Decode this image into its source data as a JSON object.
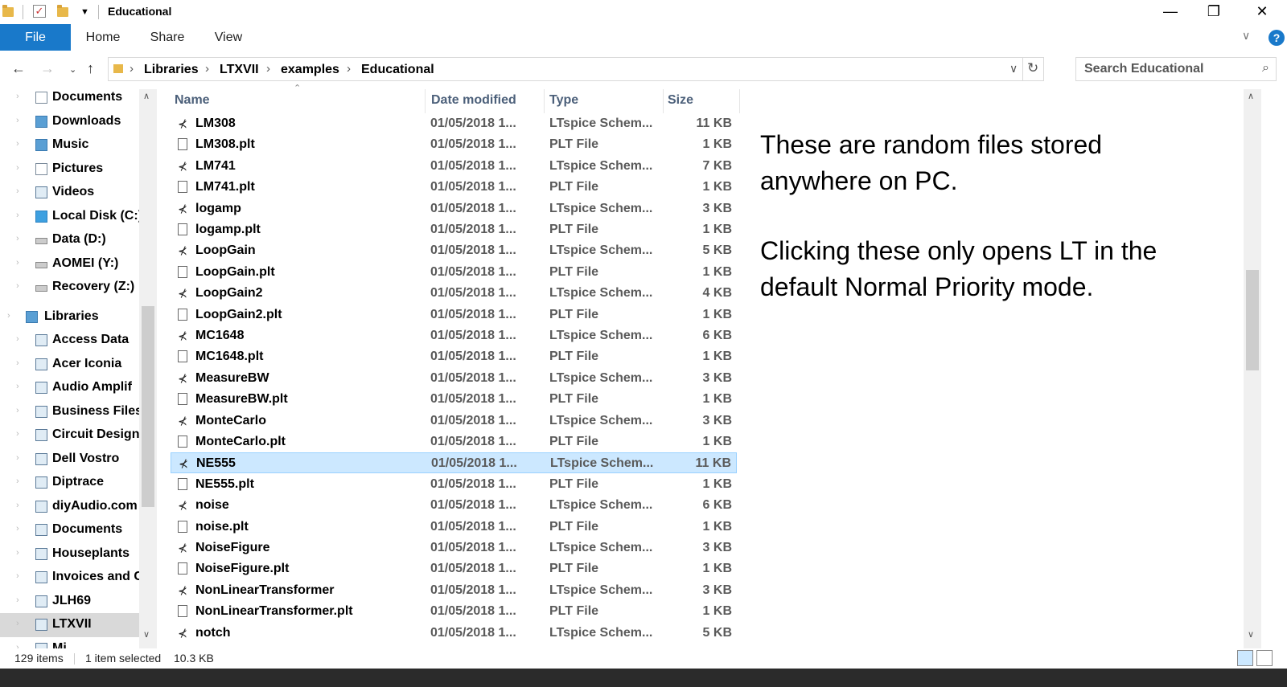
{
  "window": {
    "title": "Educational",
    "minimize": "—",
    "maximize": "❐",
    "close": "✕"
  },
  "ribbon": {
    "tabs": [
      "File",
      "Home",
      "Share",
      "View"
    ],
    "help": "?",
    "expand": "∨"
  },
  "address": {
    "crumbs": [
      "Libraries",
      "LTXVII",
      "examples",
      "Educational"
    ],
    "separator": "›",
    "search_placeholder": "Search Educational"
  },
  "nav": {
    "items": [
      {
        "label": "Documents",
        "icon": "documents-icon",
        "level": "child"
      },
      {
        "label": "Downloads",
        "icon": "downloads-icon",
        "level": "child"
      },
      {
        "label": "Music",
        "icon": "music-icon",
        "level": "child"
      },
      {
        "label": "Pictures",
        "icon": "pictures-icon",
        "level": "child"
      },
      {
        "label": "Videos",
        "icon": "videos-icon",
        "level": "child"
      },
      {
        "label": "Local Disk (C:)",
        "icon": "windows-drive-icon",
        "level": "child"
      },
      {
        "label": "Data (D:)",
        "icon": "drive-icon",
        "level": "child"
      },
      {
        "label": "AOMEI (Y:)",
        "icon": "drive-icon",
        "level": "child"
      },
      {
        "label": "Recovery (Z:)",
        "icon": "drive-icon",
        "level": "child"
      },
      {
        "label": "Libraries",
        "icon": "libraries-icon",
        "level": "root"
      },
      {
        "label": "Access Data",
        "icon": "library-icon",
        "level": "child"
      },
      {
        "label": "Acer Iconia",
        "icon": "library-icon",
        "level": "child"
      },
      {
        "label": "Audio Amplif",
        "icon": "library-icon",
        "level": "child"
      },
      {
        "label": "Business Files",
        "icon": "library-icon",
        "level": "child"
      },
      {
        "label": "Circuit Design",
        "icon": "library-icon",
        "level": "child"
      },
      {
        "label": "Dell Vostro",
        "icon": "library-icon",
        "level": "child"
      },
      {
        "label": "Diptrace",
        "icon": "library-icon",
        "level": "child"
      },
      {
        "label": "diyAudio.com",
        "icon": "library-icon",
        "level": "child"
      },
      {
        "label": "Documents",
        "icon": "library-icon",
        "level": "child"
      },
      {
        "label": "Houseplants",
        "icon": "library-icon",
        "level": "child"
      },
      {
        "label": "Invoices and C",
        "icon": "library-icon",
        "level": "child"
      },
      {
        "label": "JLH69",
        "icon": "library-icon",
        "level": "child"
      },
      {
        "label": "LTXVII",
        "icon": "library-icon",
        "level": "child",
        "selected": true
      },
      {
        "label": "Mi",
        "icon": "library-icon",
        "level": "child"
      }
    ]
  },
  "columns": {
    "name": "Name",
    "date": "Date modified",
    "type": "Type",
    "size": "Size"
  },
  "files": [
    {
      "name": "LM308",
      "date": "01/05/2018 1...",
      "type": "LTspice Schem...",
      "size": "11 KB",
      "kind": "schematic"
    },
    {
      "name": "LM308.plt",
      "date": "01/05/2018 1...",
      "type": "PLT File",
      "size": "1 KB",
      "kind": "plt"
    },
    {
      "name": "LM741",
      "date": "01/05/2018 1...",
      "type": "LTspice Schem...",
      "size": "7 KB",
      "kind": "schematic"
    },
    {
      "name": "LM741.plt",
      "date": "01/05/2018 1...",
      "type": "PLT File",
      "size": "1 KB",
      "kind": "plt"
    },
    {
      "name": "logamp",
      "date": "01/05/2018 1...",
      "type": "LTspice Schem...",
      "size": "3 KB",
      "kind": "schematic"
    },
    {
      "name": "logamp.plt",
      "date": "01/05/2018 1...",
      "type": "PLT File",
      "size": "1 KB",
      "kind": "plt"
    },
    {
      "name": "LoopGain",
      "date": "01/05/2018 1...",
      "type": "LTspice Schem...",
      "size": "5 KB",
      "kind": "schematic"
    },
    {
      "name": "LoopGain.plt",
      "date": "01/05/2018 1...",
      "type": "PLT File",
      "size": "1 KB",
      "kind": "plt"
    },
    {
      "name": "LoopGain2",
      "date": "01/05/2018 1...",
      "type": "LTspice Schem...",
      "size": "4 KB",
      "kind": "schematic"
    },
    {
      "name": "LoopGain2.plt",
      "date": "01/05/2018 1...",
      "type": "PLT File",
      "size": "1 KB",
      "kind": "plt"
    },
    {
      "name": "MC1648",
      "date": "01/05/2018 1...",
      "type": "LTspice Schem...",
      "size": "6 KB",
      "kind": "schematic"
    },
    {
      "name": "MC1648.plt",
      "date": "01/05/2018 1...",
      "type": "PLT File",
      "size": "1 KB",
      "kind": "plt"
    },
    {
      "name": "MeasureBW",
      "date": "01/05/2018 1...",
      "type": "LTspice Schem...",
      "size": "3 KB",
      "kind": "schematic"
    },
    {
      "name": "MeasureBW.plt",
      "date": "01/05/2018 1...",
      "type": "PLT File",
      "size": "1 KB",
      "kind": "plt"
    },
    {
      "name": "MonteCarlo",
      "date": "01/05/2018 1...",
      "type": "LTspice Schem...",
      "size": "3 KB",
      "kind": "schematic"
    },
    {
      "name": "MonteCarlo.plt",
      "date": "01/05/2018 1...",
      "type": "PLT File",
      "size": "1 KB",
      "kind": "plt"
    },
    {
      "name": "NE555",
      "date": "01/05/2018 1...",
      "type": "LTspice Schem...",
      "size": "11 KB",
      "kind": "schematic",
      "selected": true
    },
    {
      "name": "NE555.plt",
      "date": "01/05/2018 1...",
      "type": "PLT File",
      "size": "1 KB",
      "kind": "plt"
    },
    {
      "name": "noise",
      "date": "01/05/2018 1...",
      "type": "LTspice Schem...",
      "size": "6 KB",
      "kind": "schematic"
    },
    {
      "name": "noise.plt",
      "date": "01/05/2018 1...",
      "type": "PLT File",
      "size": "1 KB",
      "kind": "plt"
    },
    {
      "name": "NoiseFigure",
      "date": "01/05/2018 1...",
      "type": "LTspice Schem...",
      "size": "3 KB",
      "kind": "schematic"
    },
    {
      "name": "NoiseFigure.plt",
      "date": "01/05/2018 1...",
      "type": "PLT File",
      "size": "1 KB",
      "kind": "plt"
    },
    {
      "name": "NonLinearTransformer",
      "date": "01/05/2018 1...",
      "type": "LTspice Schem...",
      "size": "3 KB",
      "kind": "schematic"
    },
    {
      "name": "NonLinearTransformer.plt",
      "date": "01/05/2018 1...",
      "type": "PLT File",
      "size": "1 KB",
      "kind": "plt"
    },
    {
      "name": "notch",
      "date": "01/05/2018 1...",
      "type": "LTspice Schem...",
      "size": "5 KB",
      "kind": "schematic"
    }
  ],
  "annotation": {
    "line1": "These are random files stored anywhere on PC.",
    "line2": "Clicking these only opens LT in the default Normal Priority mode."
  },
  "status": {
    "count": "129 items",
    "selected": "1 item selected",
    "size": "10.3 KB"
  },
  "colors": {
    "accent": "#1979ca",
    "selected_row": "#cce8ff"
  }
}
